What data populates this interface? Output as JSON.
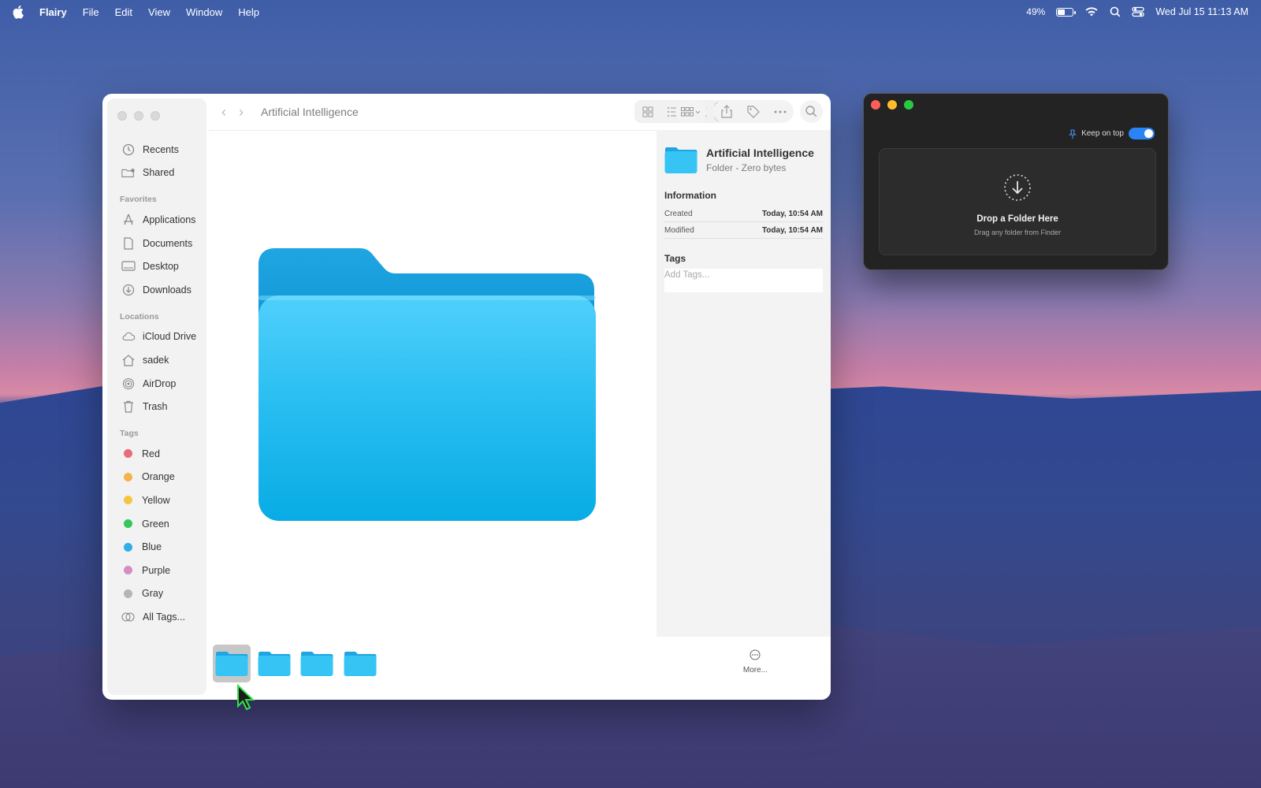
{
  "menubar": {
    "app_name": "Flairy",
    "menus": [
      "File",
      "Edit",
      "View",
      "Window",
      "Help"
    ],
    "battery": "49%",
    "battery_level": 0.49,
    "datetime": "Wed Jul 15  11:13 AM"
  },
  "finder": {
    "title": "Artificial Intelligence",
    "sidebar": {
      "top_items": [
        {
          "label": "Recents",
          "icon": "clock-icon"
        },
        {
          "label": "Shared",
          "icon": "shared-folder-icon"
        }
      ],
      "favorites_header": "Favorites",
      "favorites": [
        {
          "label": "Applications",
          "icon": "applications-icon"
        },
        {
          "label": "Documents",
          "icon": "document-icon"
        },
        {
          "label": "Desktop",
          "icon": "desktop-icon"
        },
        {
          "label": "Downloads",
          "icon": "download-icon"
        }
      ],
      "locations_header": "Locations",
      "locations": [
        {
          "label": "iCloud Drive",
          "icon": "cloud-icon"
        },
        {
          "label": "sadek",
          "icon": "home-icon"
        },
        {
          "label": "AirDrop",
          "icon": "airdrop-icon"
        },
        {
          "label": "Trash",
          "icon": "trash-icon"
        }
      ],
      "tags_header": "Tags",
      "tags": [
        {
          "label": "Red",
          "color": "#e86c7b"
        },
        {
          "label": "Orange",
          "color": "#f3b34a"
        },
        {
          "label": "Yellow",
          "color": "#f4c542"
        },
        {
          "label": "Green",
          "color": "#34c759"
        },
        {
          "label": "Blue",
          "color": "#32ade6"
        },
        {
          "label": "Purple",
          "color": "#d38fc1"
        },
        {
          "label": "Gray",
          "color": "#b5b5b5"
        }
      ],
      "all_tags": "All Tags..."
    },
    "inspector": {
      "name": "Artificial Intelligence",
      "kind": "Folder - Zero bytes",
      "information_header": "Information",
      "created_label": "Created",
      "created_value": "Today, 10:54 AM",
      "modified_label": "Modified",
      "modified_value": "Today, 10:54 AM",
      "tags_header": "Tags",
      "tags_placeholder": "Add Tags..."
    },
    "more_label": "More..."
  },
  "flairy_window": {
    "keep_on_top_label": "Keep on top",
    "keep_on_top": true,
    "drop_title": "Drop a Folder Here",
    "drop_subtitle": "Drag any folder from Finder"
  }
}
